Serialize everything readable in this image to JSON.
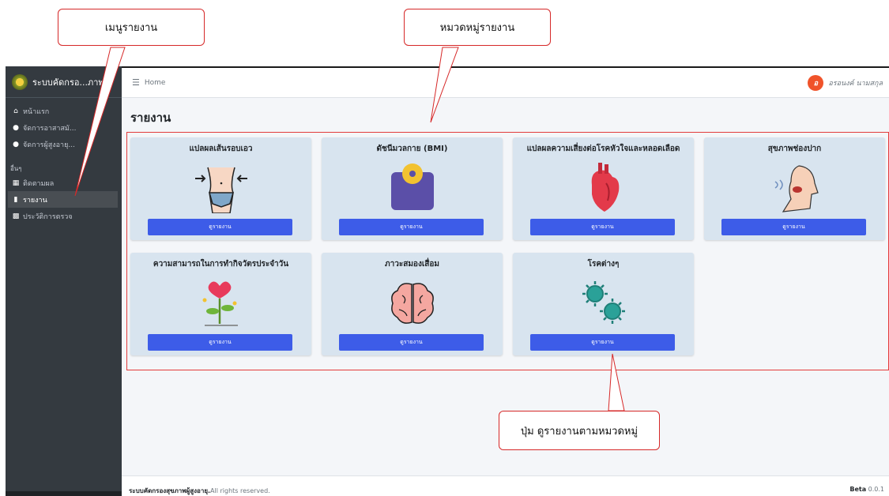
{
  "app": {
    "brand": "ระบบคัดกรอ...ภาพ",
    "breadcrumb": "Home",
    "user_initial": "อ",
    "user_name": "อรอนงค์ นามสกุล"
  },
  "sidebar": {
    "items": [
      {
        "label": "หน้าแรก",
        "icon": "home-icon"
      },
      {
        "label": "จัดการอาสาสมั...",
        "icon": "users-icon"
      },
      {
        "label": "จัดการผู้สูงอายุ...",
        "icon": "users-group-icon"
      }
    ],
    "section_header": "อื่นๆ",
    "items2": [
      {
        "label": "ติดตามผล",
        "icon": "calendar-icon"
      },
      {
        "label": "รายงาน",
        "icon": "file-icon",
        "active": true
      },
      {
        "label": "ประวัติการตรวจ",
        "icon": "copy-icon"
      }
    ]
  },
  "page": {
    "title": "รายงาน"
  },
  "cards": [
    {
      "title": "แปลผลเส้นรอบเอว",
      "icon": "waist-icon",
      "button": "ดูรายงาน"
    },
    {
      "title": "ดัชนีมวลกาย (BMI)",
      "icon": "scale-icon",
      "button": "ดูรายงาน"
    },
    {
      "title": "แปลผลความเสี่ยงต่อโรคหัวใจและหลอดเลือด",
      "icon": "heart-icon",
      "button": "ดูรายงาน"
    },
    {
      "title": "สุขภาพช่องปาก",
      "icon": "mouth-icon",
      "button": "ดูรายงาน"
    },
    {
      "title": "ความสามารถในการทำกิจวัตรประจำวัน",
      "icon": "flower-icon",
      "button": "ดูรายงาน"
    },
    {
      "title": "ภาวะสมองเสื่อม",
      "icon": "brain-icon",
      "button": "ดูรายงาน"
    },
    {
      "title": "โรคต่างๆ",
      "icon": "virus-icon",
      "button": "ดูรายงาน"
    }
  ],
  "footer": {
    "left_bold": "ระบบคัดกรองสุขภาพผู้สูงอายุ.",
    "left_rest": "All rights reserved.",
    "right_bold": "Beta",
    "right_rest": "0.0.1"
  },
  "annotations": {
    "menu_callout": "เมนูรายงาน",
    "category_callout": "หมวดหมู่รายงาน",
    "button_callout": "ปุ่ม ดูรายงานตามหมวดหมู่"
  },
  "colors": {
    "sidebar": "#343a40",
    "card": "#d8e4ef",
    "button": "#3d5ce8",
    "annotation": "#e23b3b"
  }
}
